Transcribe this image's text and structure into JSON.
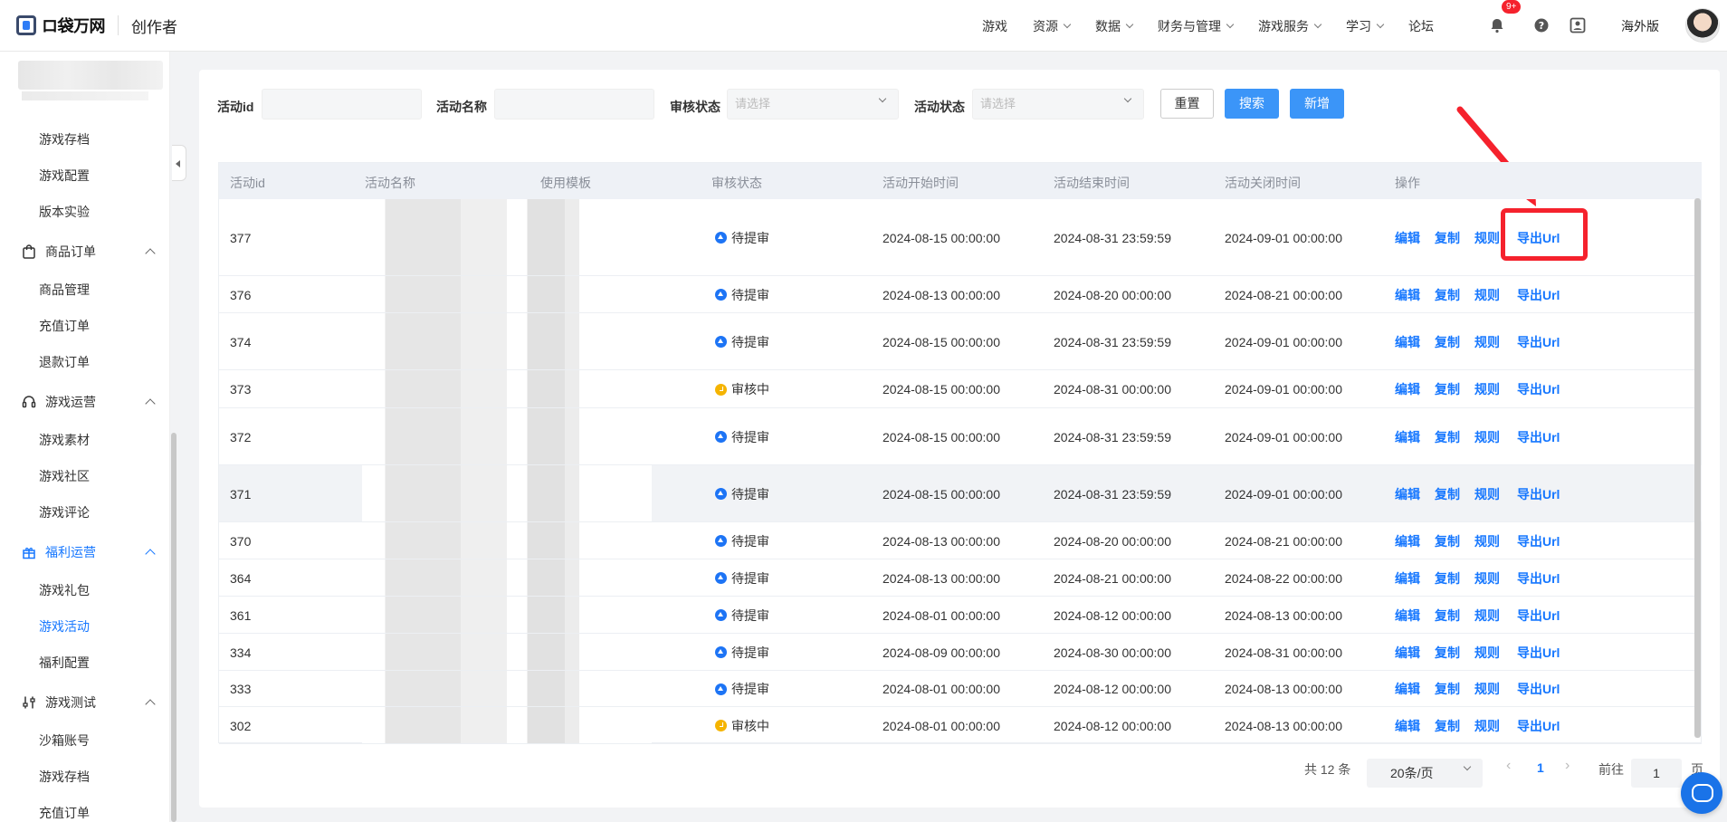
{
  "header": {
    "logo_text": "ロ袋万网",
    "app_title": "创作者",
    "nav": [
      {
        "label": "游戏",
        "dropdown": false
      },
      {
        "label": "资源",
        "dropdown": true
      },
      {
        "label": "数据",
        "dropdown": true
      },
      {
        "label": "财务与管理",
        "dropdown": true
      },
      {
        "label": "游戏服务",
        "dropdown": true
      },
      {
        "label": "学习",
        "dropdown": true
      },
      {
        "label": "论坛",
        "dropdown": false
      }
    ],
    "notification_badge": "9+",
    "region_label": "海外版",
    "icons": [
      "bell-icon",
      "help-icon",
      "user-card-icon"
    ]
  },
  "sidebar": {
    "items": [
      {
        "type": "item",
        "label": "游戏存档"
      },
      {
        "type": "item",
        "label": "游戏配置"
      },
      {
        "type": "item",
        "label": "版本实验"
      },
      {
        "type": "group",
        "label": "商品订单",
        "icon": "bag-icon"
      },
      {
        "type": "item",
        "label": "商品管理"
      },
      {
        "type": "item",
        "label": "充值订单"
      },
      {
        "type": "item",
        "label": "退款订单"
      },
      {
        "type": "group",
        "label": "游戏运营",
        "icon": "headset-icon"
      },
      {
        "type": "item",
        "label": "游戏素材"
      },
      {
        "type": "item",
        "label": "游戏社区"
      },
      {
        "type": "item",
        "label": "游戏评论"
      },
      {
        "type": "group",
        "label": "福利运营",
        "icon": "gift-icon",
        "active": true
      },
      {
        "type": "item",
        "label": "游戏礼包"
      },
      {
        "type": "item",
        "label": "游戏活动",
        "active": true
      },
      {
        "type": "item",
        "label": "福利配置"
      },
      {
        "type": "group",
        "label": "游戏测试",
        "icon": "sliders-icon"
      },
      {
        "type": "item",
        "label": "沙箱账号"
      },
      {
        "type": "item",
        "label": "游戏存档"
      },
      {
        "type": "item",
        "label": "充值订单"
      }
    ]
  },
  "filters": {
    "activity_id_label": "活动id",
    "activity_id_value": "",
    "activity_name_label": "活动名称",
    "activity_name_value": "",
    "review_status_label": "审核状态",
    "review_status_placeholder": "请选择",
    "activity_status_label": "活动状态",
    "activity_status_placeholder": "请选择",
    "reset_label": "重置",
    "search_label": "搜索",
    "add_label": "新增"
  },
  "table": {
    "columns": [
      "活动id",
      "活动名称",
      "使用模板",
      "审核状态",
      "活动开始时间",
      "活动结束时间",
      "活动关闭时间",
      "操作"
    ],
    "rows": [
      {
        "id": "377",
        "status": "待提审",
        "status_type": "pending",
        "start": "2024-08-15 00:00:00",
        "end": "2024-08-31 23:59:59",
        "close": "2024-09-01 00:00:00"
      },
      {
        "id": "376",
        "status": "待提审",
        "status_type": "pending",
        "start": "2024-08-13 00:00:00",
        "end": "2024-08-20 00:00:00",
        "close": "2024-08-21 00:00:00"
      },
      {
        "id": "374",
        "status": "待提审",
        "status_type": "pending",
        "start": "2024-08-15 00:00:00",
        "end": "2024-08-31 23:59:59",
        "close": "2024-09-01 00:00:00"
      },
      {
        "id": "373",
        "status": "审核中",
        "status_type": "review",
        "start": "2024-08-15 00:00:00",
        "end": "2024-08-31 00:00:00",
        "close": "2024-09-01 00:00:00"
      },
      {
        "id": "372",
        "status": "待提审",
        "status_type": "pending",
        "start": "2024-08-15 00:00:00",
        "end": "2024-08-31 23:59:59",
        "close": "2024-09-01 00:00:00"
      },
      {
        "id": "371",
        "status": "待提审",
        "status_type": "pending",
        "start": "2024-08-15 00:00:00",
        "end": "2024-08-31 23:59:59",
        "close": "2024-09-01 00:00:00",
        "highlighted": true
      },
      {
        "id": "370",
        "status": "待提审",
        "status_type": "pending",
        "start": "2024-08-13 00:00:00",
        "end": "2024-08-20 00:00:00",
        "close": "2024-08-21 00:00:00"
      },
      {
        "id": "364",
        "status": "待提审",
        "status_type": "pending",
        "start": "2024-08-13 00:00:00",
        "end": "2024-08-21 00:00:00",
        "close": "2024-08-22 00:00:00"
      },
      {
        "id": "361",
        "status": "待提审",
        "status_type": "pending",
        "start": "2024-08-01 00:00:00",
        "end": "2024-08-12 00:00:00",
        "close": "2024-08-13 00:00:00"
      },
      {
        "id": "334",
        "status": "待提审",
        "status_type": "pending",
        "start": "2024-08-09 00:00:00",
        "end": "2024-08-30 00:00:00",
        "close": "2024-08-31 00:00:00"
      },
      {
        "id": "333",
        "status": "待提审",
        "status_type": "pending",
        "start": "2024-08-01 00:00:00",
        "end": "2024-08-12 00:00:00",
        "close": "2024-08-13 00:00:00"
      },
      {
        "id": "302",
        "status": "审核中",
        "status_type": "review",
        "start": "2024-08-01 00:00:00",
        "end": "2024-08-12 00:00:00",
        "close": "2024-08-13 00:00:00"
      }
    ],
    "actions": [
      "编辑",
      "复制",
      "规则",
      "导出Url"
    ]
  },
  "pagination": {
    "total": "共 12 条",
    "page_size": "20条/页",
    "current_page": "1",
    "goto_label": "前往",
    "goto_value": "1",
    "page_suffix": "页"
  },
  "colors": {
    "accent": "#1677ff",
    "primary_button": "#3b95f8",
    "pending_icon": "#1d74f5",
    "review_icon": "#f5b400",
    "annotation_red": "#f5222d"
  }
}
